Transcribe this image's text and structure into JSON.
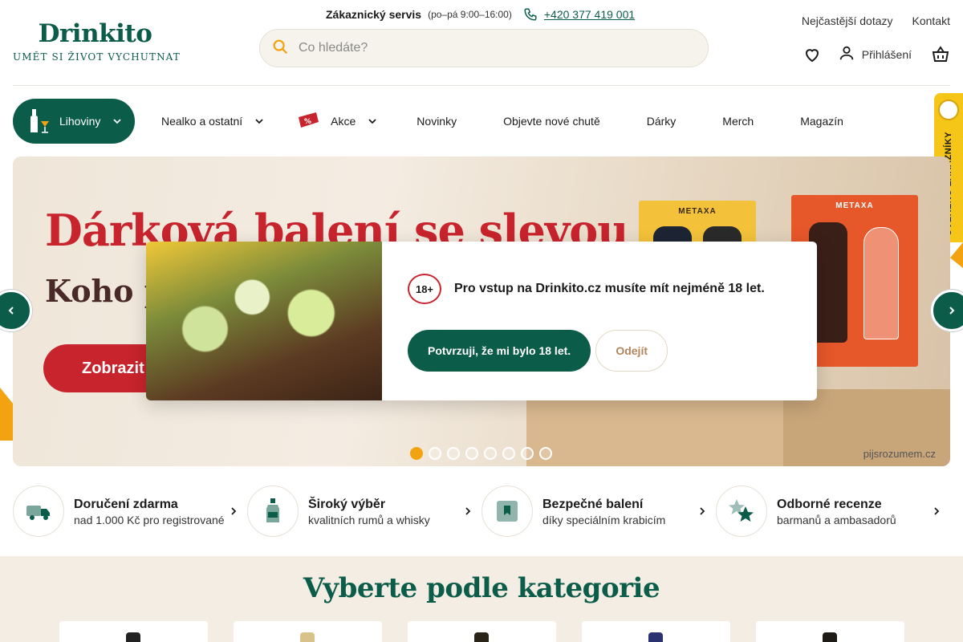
{
  "header": {
    "logo": {
      "name": "Drinkito",
      "tagline": "UMĚT SI ŽIVOT VYCHUTNAT"
    },
    "service": {
      "title": "Zákaznický servis",
      "hours": "(po–pá 9:00–16:00)",
      "phone": "+420 377 419 001"
    },
    "search": {
      "placeholder": "Co hledáte?"
    },
    "top_links": [
      "Nejčastější dotazy",
      "Kontakt"
    ],
    "login_label": "Přihlášení"
  },
  "nav": {
    "items": [
      {
        "label": "Lihoviny",
        "active": true,
        "dropdown": true
      },
      {
        "label": "Nealko a ostatní",
        "dropdown": true
      },
      {
        "label": "Akce",
        "dropdown": true
      },
      {
        "label": "Novinky"
      },
      {
        "label": "Objevte nové chutě"
      },
      {
        "label": "Dárky"
      },
      {
        "label": "Merch"
      },
      {
        "label": "Magazín"
      }
    ]
  },
  "verified_badge": "OVĚŘENO ZÁKAZNÍKY",
  "hero": {
    "title": "Dárková balení se slevou",
    "subtitle": "Koho p",
    "button": "Zobrazit",
    "product_brand": "METAXA",
    "watermark": "pijsrozumem.cz",
    "slides_count": 8,
    "active_slide": 1
  },
  "age_gate": {
    "badge": "18+",
    "message": "Pro vstup na Drinkito.cz musíte mít nejméně 18 let.",
    "confirm_label": "Potvrzuji, že mi bylo 18 let.",
    "leave_label": "Odejít"
  },
  "benefits": [
    {
      "title": "Doručení zdarma",
      "subtitle": "nad 1.000 Kč pro registrované",
      "icon": "truck-icon"
    },
    {
      "title": "Široký výběr",
      "subtitle": "kvalitních rumů a whisky",
      "icon": "bottle-icon"
    },
    {
      "title": "Bezpečné balení",
      "subtitle": "díky speciálním krabicím",
      "icon": "box-icon"
    },
    {
      "title": "Odborné recenze",
      "subtitle": "barmanů a ambasadorů",
      "icon": "star-icon"
    }
  ],
  "categories": {
    "title": "Vyberte podle kategorie"
  },
  "colors": {
    "brand_green": "#0c5c4a",
    "accent_orange": "#f2a30f",
    "hero_red": "#c8242d",
    "badge_yellow": "#f5c518"
  }
}
